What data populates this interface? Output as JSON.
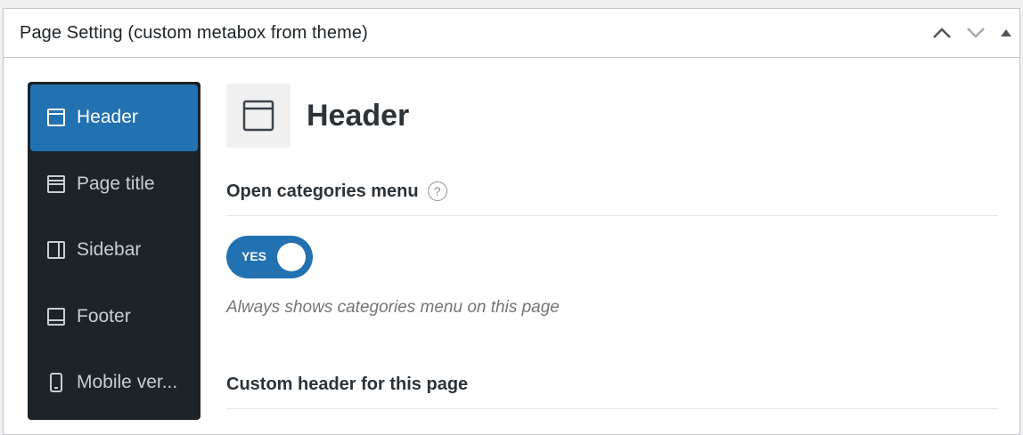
{
  "metabox": {
    "title": "Page Setting (custom metabox from theme)",
    "actions": [
      {
        "icon": "chevron-up-icon"
      },
      {
        "icon": "chevron-down-icon"
      },
      {
        "icon": "triangle-up-icon"
      }
    ]
  },
  "sidebar": {
    "items": [
      {
        "label": "Header",
        "icon": "header-layout-icon",
        "active": true
      },
      {
        "label": "Page title",
        "icon": "page-title-icon",
        "active": false
      },
      {
        "label": "Sidebar",
        "icon": "sidebar-layout-icon",
        "active": false
      },
      {
        "label": "Footer",
        "icon": "footer-layout-icon",
        "active": false
      },
      {
        "label": "Mobile ver...",
        "icon": "mobile-icon",
        "active": false
      }
    ]
  },
  "section": {
    "title": "Header",
    "icon": "header-layout-icon"
  },
  "fields": {
    "open_categories": {
      "label": "Open categories menu",
      "help": "?",
      "toggle_text": "YES",
      "toggle_on": true,
      "description": "Always shows categories menu on this page"
    },
    "custom_header": {
      "label": "Custom header for this page"
    }
  },
  "colors": {
    "accent": "#2271b1",
    "sidebar_bg": "#1d2327"
  }
}
